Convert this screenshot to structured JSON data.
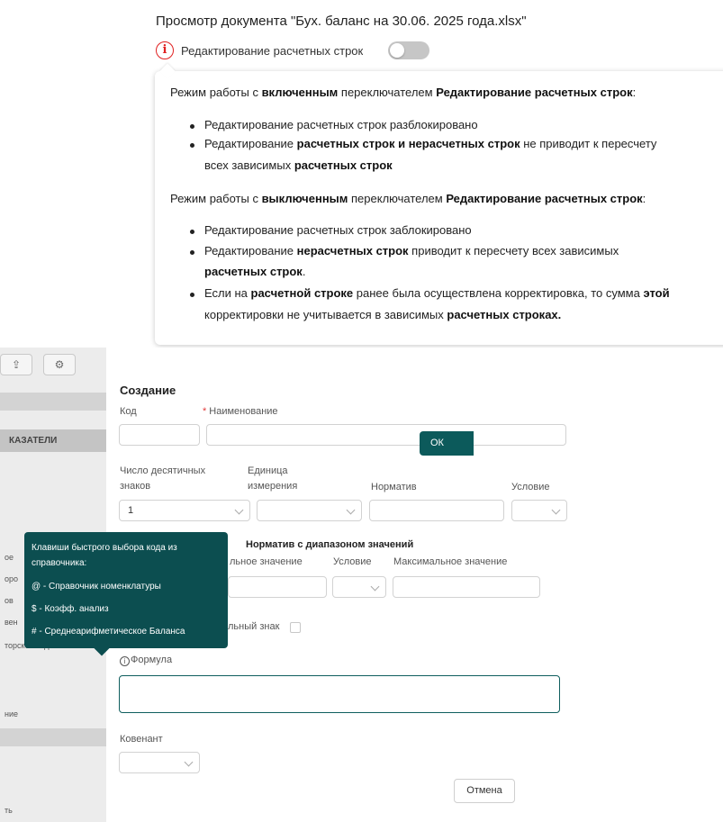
{
  "preview": {
    "title": "Просмотр документа \"Бух. баланс на 30.06. 2025 года.xlsx\"",
    "toggle_label": "Редактирование расчетных строк",
    "toggle_state": "off",
    "info_glyph": "i",
    "popover": {
      "on_intro_1": "Режим работы с ",
      "on_intro_2": "включенным",
      "on_intro_3": " переключателем ",
      "on_intro_4": "Редактирование расчетных строк",
      "on_intro_5": ":",
      "on_b1": "Редактирование расчетных строк разблокировано",
      "on_b2_1": "Редактирование ",
      "on_b2_2": "расчетных строк и нерасчетных строк",
      "on_b2_3": " не приводит к пересчету",
      "on_b2_4": "всех зависимых ",
      "on_b2_5": "расчетных строк",
      "off_intro_1": "Режим работы с ",
      "off_intro_2": "выключенным",
      "off_intro_3": " переключателем ",
      "off_intro_4": "Редактирование расчетных строк",
      "off_intro_5": ":",
      "off_b1": "Редактирование расчетных строк заблокировано",
      "off_b2_1": "Редактирование ",
      "off_b2_2": "нерасчетных строк",
      "off_b2_3": " приводит к пересчету всех зависимых",
      "off_b2_4": "расчетных строк",
      "off_b2_5": ".",
      "off_b3_1": "Если на ",
      "off_b3_2": "расчетной строке",
      "off_b3_3": " ранее была осуществлена корректировка, то сумма ",
      "off_b3_4": "этой",
      "off_b3_5": "корректировки не учитывается в зависимых ",
      "off_b3_6": "расчетных строках."
    }
  },
  "background": {
    "section_header": "КАЗАТЕЛИ",
    "side_items": [
      "ое",
      "оро",
      "ов",
      "вен",
      "торской задолженно",
      "ние",
      "ть"
    ]
  },
  "form": {
    "title": "Создание",
    "code_label": "Код",
    "name_label": "Наименование",
    "decimals_label": "Число десятичных знаков",
    "decimals_value": "1",
    "unit_label": "Единица измерения",
    "normative_label": "Норматив",
    "condition_label": "Условие",
    "range_section_title": "Норматив с диапазоном значений",
    "min_value_label_partial": "льное значение",
    "range_condition_label": "Условие",
    "max_value_label": "Максимальное значение",
    "sign_label_partial": "льный знак",
    "formula_label": "Формула",
    "covenant_label": "Ковенант",
    "cancel_label": "Отмена",
    "ok_label_partial": "ОК"
  },
  "tooltip": {
    "title_line1": "Клавиши быстрого выбора кода из",
    "title_line2": "справочника:",
    "items": [
      "@ - Справочник номенклатуры",
      "$ - Коэфф. анализ",
      "# - Среднеарифметическое Баланса"
    ]
  },
  "colors": {
    "accent": "#0c5a5b",
    "tooltip_bg": "#0c4e50",
    "info_red": "#e02020",
    "required_star": "#e23a3a"
  },
  "icons": [
    "info-icon",
    "chevron-down-icon",
    "formula-info-icon"
  ]
}
